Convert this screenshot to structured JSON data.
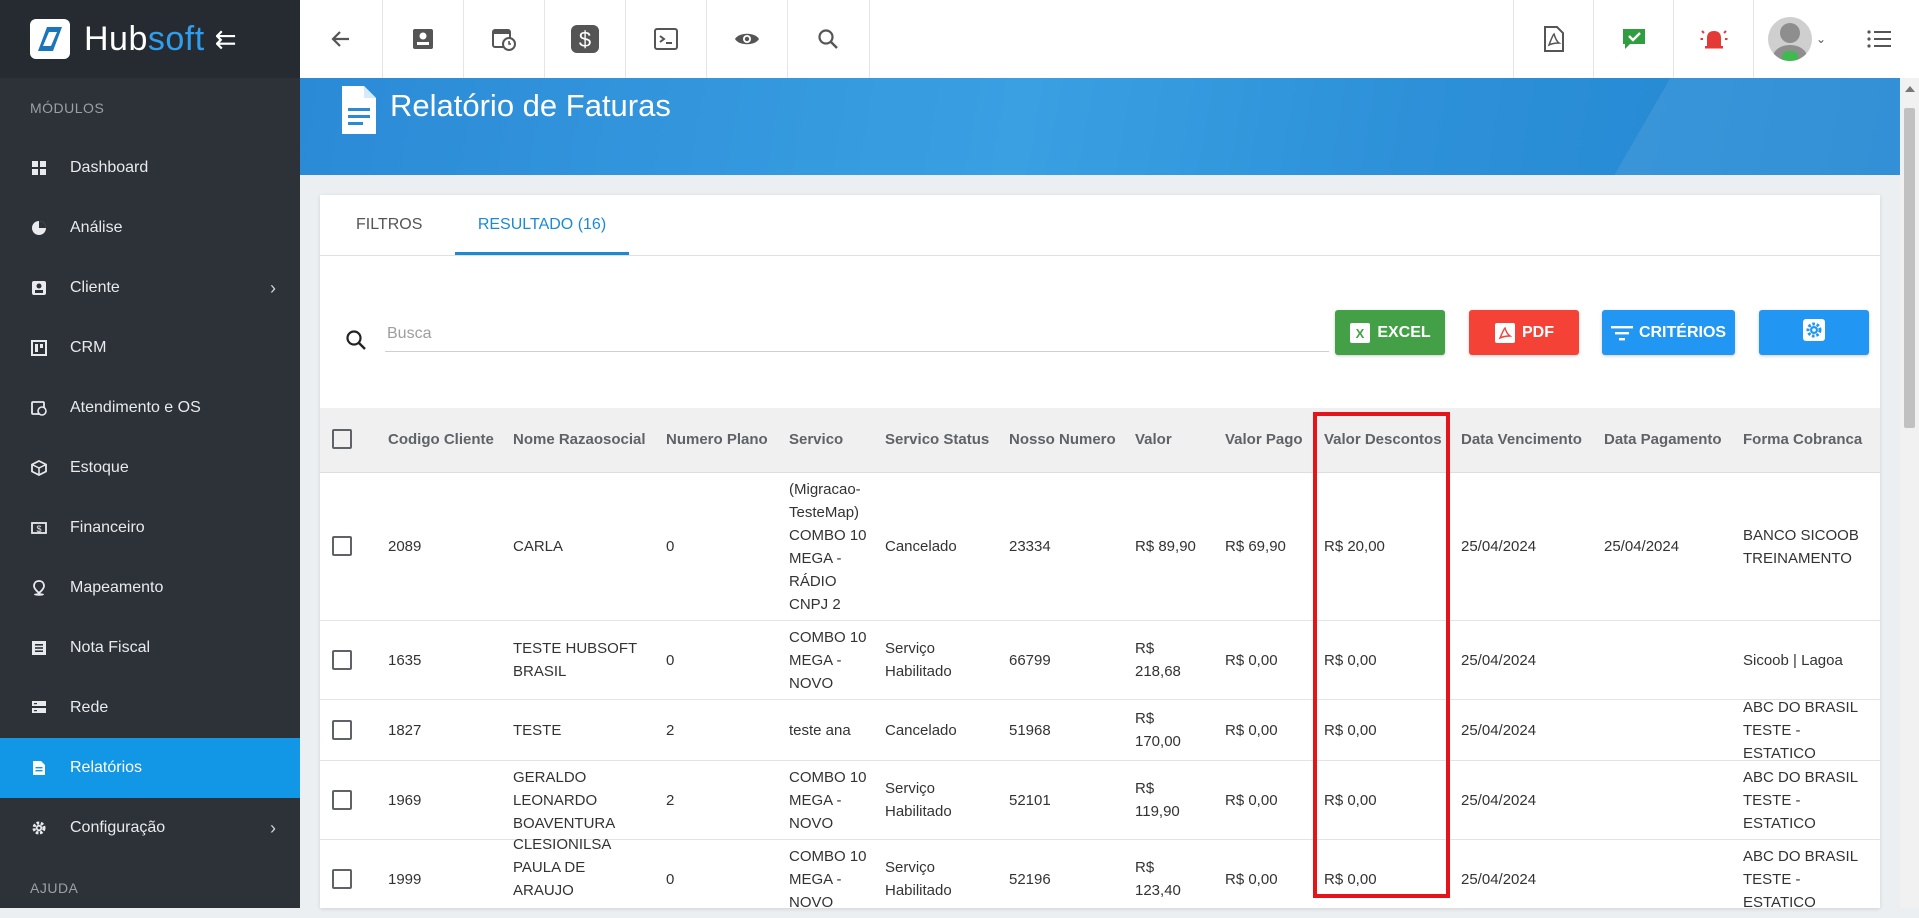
{
  "brand": {
    "name_a": "Hub",
    "name_b": "soft"
  },
  "sidebar": {
    "section_modules": "MÓDULOS",
    "section_help": "AJUDA",
    "items": [
      {
        "label": "Dashboard",
        "icon": "dashboard-icon"
      },
      {
        "label": "Análise",
        "icon": "pie-chart-icon"
      },
      {
        "label": "Cliente",
        "icon": "contact-card-icon",
        "chevron": true
      },
      {
        "label": "CRM",
        "icon": "kanban-icon"
      },
      {
        "label": "Atendimento e OS",
        "icon": "calendar-clock-icon"
      },
      {
        "label": "Estoque",
        "icon": "box-icon"
      },
      {
        "label": "Financeiro",
        "icon": "money-icon"
      },
      {
        "label": "Mapeamento",
        "icon": "map-pin-icon"
      },
      {
        "label": "Nota Fiscal",
        "icon": "document-list-icon"
      },
      {
        "label": "Rede",
        "icon": "server-icon"
      },
      {
        "label": "Relatórios",
        "icon": "report-icon",
        "active": true
      },
      {
        "label": "Configuração",
        "icon": "gear-icon",
        "chevron": true
      }
    ]
  },
  "page": {
    "title": "Relatório de Faturas"
  },
  "tabs": [
    {
      "label": "FILTROS"
    },
    {
      "label": "RESULTADO (16)",
      "active": true
    }
  ],
  "search": {
    "placeholder": "Busca"
  },
  "buttons": {
    "excel": "EXCEL",
    "pdf": "PDF",
    "criterios": "CRITÉRIOS"
  },
  "colors": {
    "sidebar": "#2d3238",
    "accent": "#1296e6",
    "excel": "#43a047",
    "pdf": "#f44336",
    "criterios": "#2196f3",
    "highlight": "#e4141a"
  },
  "table": {
    "columns": [
      "Codigo Cliente",
      "Nome Razaosocial",
      "Numero Plano",
      "Servico",
      "Servico Status",
      "Nosso Numero",
      "Valor",
      "Valor Pago",
      "Valor Descontos",
      "Data Vencimento",
      "Data Pagamento",
      "Forma Cobranca"
    ],
    "rows": [
      {
        "codigo": "2089",
        "nome": "CARLA",
        "plano": "0",
        "servico": "(Migracao-TesteMap) COMBO 10 MEGA - RÁDIO CNPJ 2",
        "status": "Cancelado",
        "nosso": "23334",
        "valor": "R$ 89,90",
        "pago": "R$ 69,90",
        "descontos": "R$ 20,00",
        "vencimento": "25/04/2024",
        "pagamento": "25/04/2024",
        "forma": "BANCO SICOOB TREINAMENTO"
      },
      {
        "codigo": "1635",
        "nome": "TESTE HUBSOFT BRASIL",
        "plano": "0",
        "servico": "COMBO 10 MEGA - NOVO",
        "status": "Serviço Habilitado",
        "nosso": "66799",
        "valor": "R$ 218,68",
        "pago": "R$ 0,00",
        "descontos": "R$ 0,00",
        "vencimento": "25/04/2024",
        "pagamento": "",
        "forma": "Sicoob | Lagoa"
      },
      {
        "codigo": "1827",
        "nome": "TESTE",
        "plano": "2",
        "servico": "teste ana",
        "status": "Cancelado",
        "nosso": "51968",
        "valor": "R$ 170,00",
        "pago": "R$ 0,00",
        "descontos": "R$ 0,00",
        "vencimento": "25/04/2024",
        "pagamento": "",
        "forma": "ABC DO BRASIL TESTE - ESTATICO"
      },
      {
        "codigo": "1969",
        "nome": "GERALDO LEONARDO BOAVENTURA",
        "plano": "2",
        "servico": "COMBO 10 MEGA - NOVO",
        "status": "Serviço Habilitado",
        "nosso": "52101",
        "valor": "R$ 119,90",
        "pago": "R$ 0,00",
        "descontos": "R$ 0,00",
        "vencimento": "25/04/2024",
        "pagamento": "",
        "forma": "ABC DO BRASIL TESTE - ESTATICO"
      },
      {
        "codigo": "1999",
        "nome": "CLESIONILSA PAULA DE ARAUJO RABELO",
        "plano": "0",
        "servico": "COMBO 10 MEGA - NOVO",
        "status": "Serviço Habilitado",
        "nosso": "52196",
        "valor": "R$ 123,40",
        "pago": "R$ 0,00",
        "descontos": "R$ 0,00",
        "vencimento": "25/04/2024",
        "pagamento": "",
        "forma": "ABC DO BRASIL TESTE - ESTATICO"
      }
    ]
  }
}
